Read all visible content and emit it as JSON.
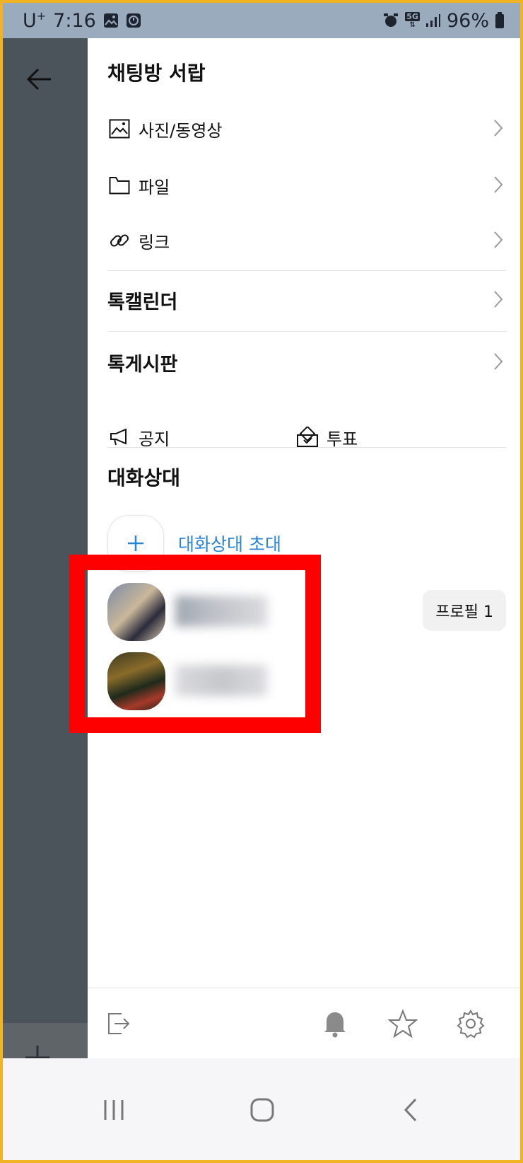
{
  "status_bar": {
    "carrier": "U",
    "carrier_sup": "+",
    "time": "7:16",
    "network": "5G",
    "battery": "96%"
  },
  "drawer": {
    "title": "채팅방 서랍",
    "media_items": [
      {
        "label": "사진/동영상",
        "icon": "photo-icon"
      },
      {
        "label": "파일",
        "icon": "folder-icon"
      },
      {
        "label": "링크",
        "icon": "link-icon"
      }
    ],
    "calendar_label": "톡캘린더",
    "board_label": "톡게시판",
    "notice_label": "공지",
    "vote_label": "투표",
    "members_title": "대화상대",
    "invite_label": "대화상대 초대",
    "members": [
      {
        "profile_button": "프로필 1"
      },
      {
        "profile_button": ""
      }
    ]
  },
  "colors": {
    "accent": "#2b84d6",
    "highlight": "#ff0000",
    "status_bar": "#9aabbe",
    "dim_overlay": "#4b535b"
  },
  "toolbar_icons": [
    "exit-icon",
    "bell-icon",
    "star-icon",
    "gear-icon"
  ],
  "navbar_icons": [
    "recent-apps-icon",
    "home-icon",
    "back-icon"
  ]
}
